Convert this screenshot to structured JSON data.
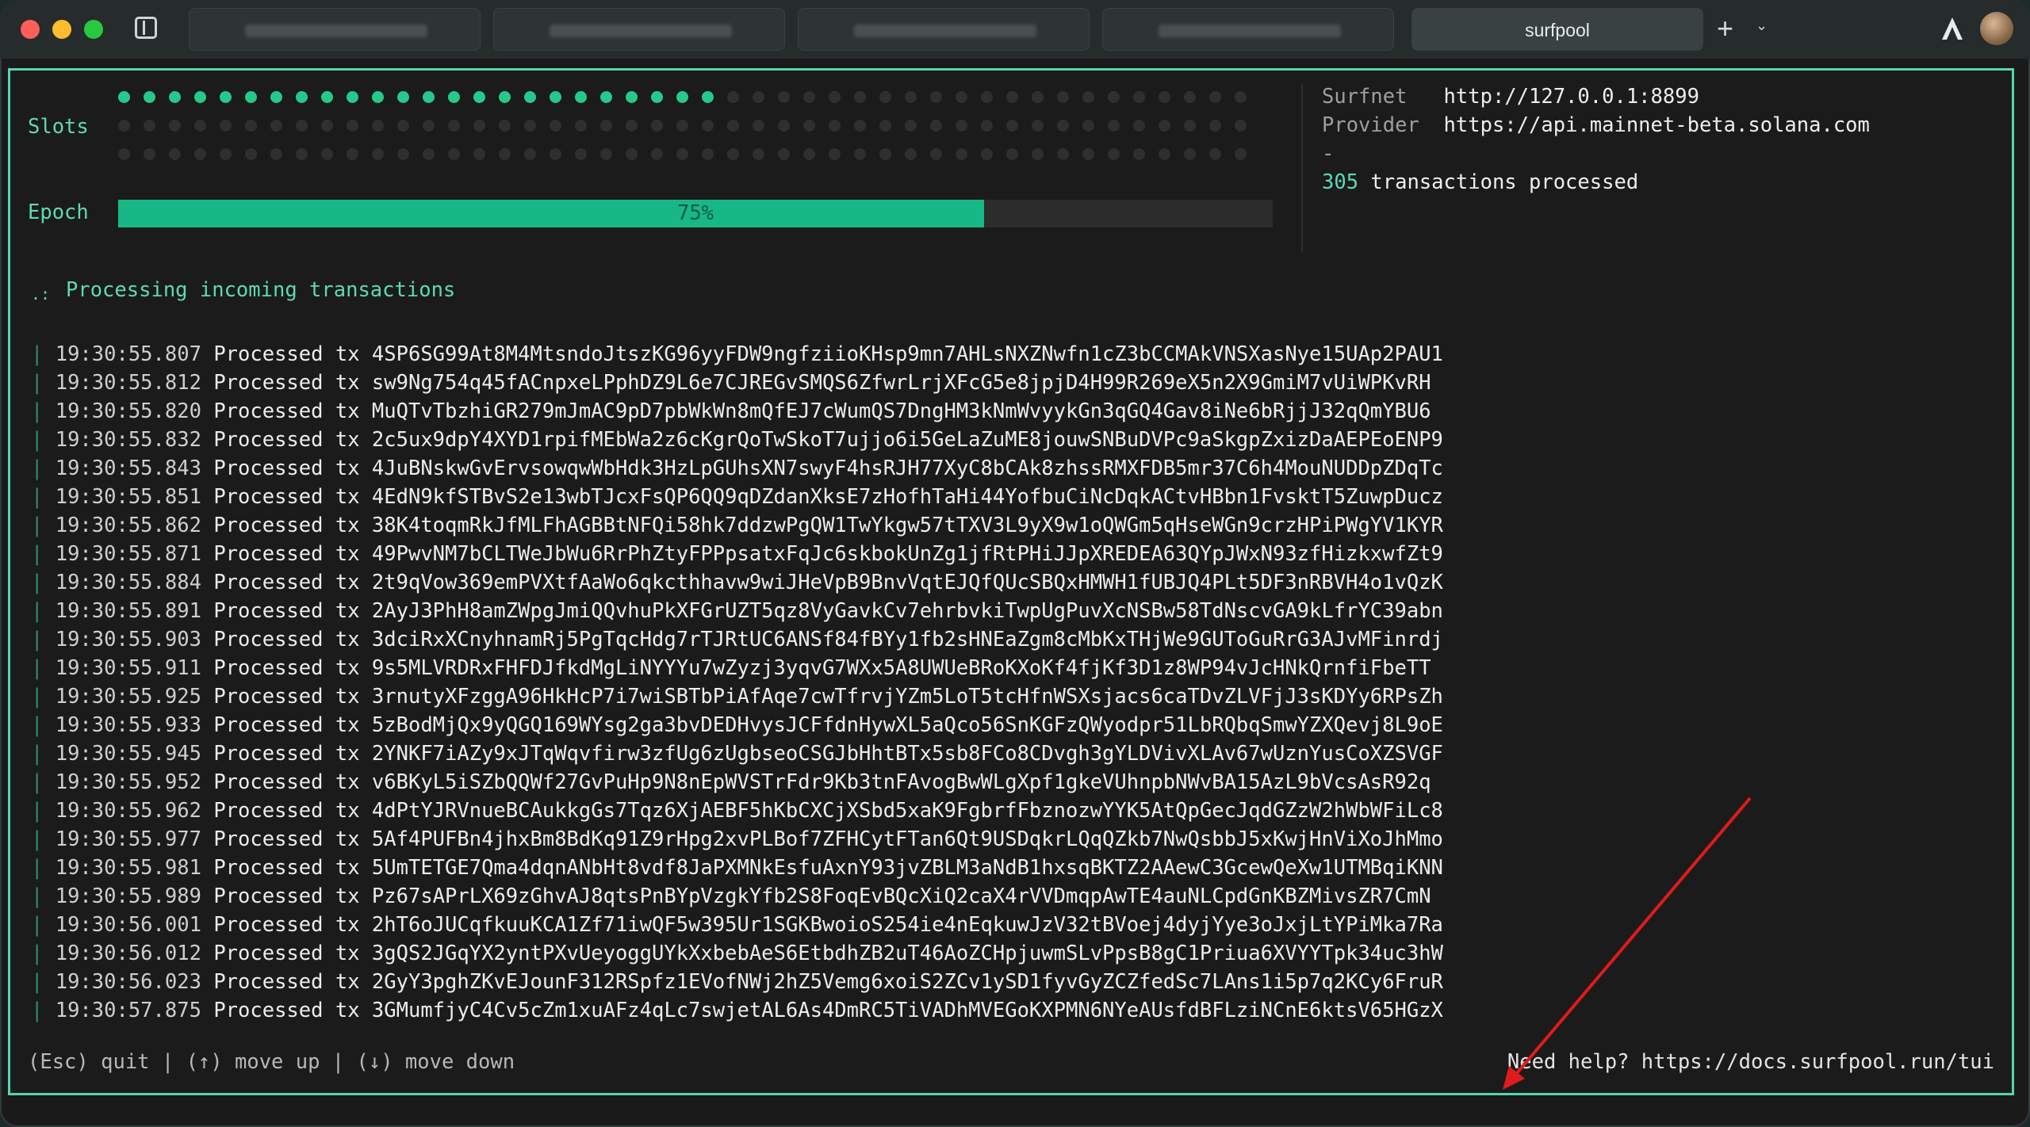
{
  "titlebar": {
    "active_tab": "surfpool"
  },
  "panel": {
    "slots_label": "Slots",
    "slots_total": 135,
    "slots_filled": 24,
    "epoch_label": "Epoch",
    "epoch_progress": 0.75,
    "epoch_percent_text": "75%",
    "surfnet_label": "Surfnet",
    "surfnet_url": "http://127.0.0.1:8899",
    "provider_label": "Provider",
    "provider_url": "https://api.mainnet-beta.solana.com",
    "separator": "-",
    "tx_count": "305",
    "tx_count_suffix": "transactions processed",
    "status_text": "Processing incoming transactions",
    "spinner_glyph": ".:"
  },
  "log": {
    "action": "Processed tx",
    "rows": [
      {
        "time": "19:30:55.807",
        "sig": "4SP6SG99At8M4MtsndoJtszKG96yyFDW9ngfziioKHsp9mn7AHLsNXZNwfn1cZ3bCCMAkVNSXasNye15UAp2PAU1"
      },
      {
        "time": "19:30:55.812",
        "sig": "sw9Ng754q45fACnpxeLPphDZ9L6e7CJREGvSMQS6ZfwrLrjXFcG5e8jpjD4H99R269eX5n2X9GmiM7vUiWPKvRH"
      },
      {
        "time": "19:30:55.820",
        "sig": "MuQTvTbzhiGR279mJmAC9pD7pbWkWn8mQfEJ7cWumQS7DngHM3kNmWvyykGn3qGQ4Gav8iNe6bRjjJ32qQmYBU6"
      },
      {
        "time": "19:30:55.832",
        "sig": "2c5ux9dpY4XYD1rpifMEbWa2z6cKgrQoTwSkoT7ujjo6i5GeLaZuME8jouwSNBuDVPc9aSkgpZxizDaAEPEoENP9"
      },
      {
        "time": "19:30:55.843",
        "sig": "4JuBNskwGvErvsowqwWbHdk3HzLpGUhsXN7swyF4hsRJH77XyC8bCAk8zhssRMXFDB5mr37C6h4MouNUDDpZDqTc"
      },
      {
        "time": "19:30:55.851",
        "sig": "4EdN9kfSTBvS2e13wbTJcxFsQP6QQ9qDZdanXksE7zHofhTaHi44YofbuCiNcDqkACtvHBbn1FvsktT5ZuwpDucz"
      },
      {
        "time": "19:30:55.862",
        "sig": "38K4toqmRkJfMLFhAGBBtNFQi58hk7ddzwPgQW1TwYkgw57tTXV3L9yX9w1oQWGm5qHseWGn9crzHPiPWgYV1KYR"
      },
      {
        "time": "19:30:55.871",
        "sig": "49PwvNM7bCLTWeJbWu6RrPhZtyFPPpsatxFqJc6skbokUnZg1jfRtPHiJJpXREDEA63QYpJWxN93zfHizkxwfZt9"
      },
      {
        "time": "19:30:55.884",
        "sig": "2t9qVow369emPVXtfAaWo6qkcthhavw9wiJHeVpB9BnvVqtEJQfQUcSBQxHMWH1fUBJQ4PLt5DF3nRBVH4o1vQzK"
      },
      {
        "time": "19:30:55.891",
        "sig": "2AyJ3PhH8amZWpgJmiQQvhuPkXFGrUZT5qz8VyGavkCv7ehrbvkiTwpUgPuvXcNSBw58TdNscvGA9kLfrYC39abn"
      },
      {
        "time": "19:30:55.903",
        "sig": "3dciRxXCnyhnamRj5PgTqcHdg7rTJRtUC6ANSf84fBYy1fb2sHNEaZgm8cMbKxTHjWe9GUToGuRrG3AJvMFinrdj"
      },
      {
        "time": "19:30:55.911",
        "sig": "9s5MLVRDRxFHFDJfkdMgLiNYYYu7wZyzj3yqvG7WXx5A8UWUeBRoKXoKf4fjKf3D1z8WP94vJcHNkQrnfiFbeTT"
      },
      {
        "time": "19:30:55.925",
        "sig": "3rnutyXFzggA96HkHcP7i7wiSBTbPiAfAqe7cwTfrvjYZm5LoT5tcHfnWSXsjacs6caTDvZLVFjJ3sKDYy6RPsZh"
      },
      {
        "time": "19:30:55.933",
        "sig": "5zBodMjQx9yQGQ169WYsg2ga3bvDEDHvysJCFfdnHywXL5aQco56SnKGFzQWyodpr51LbRQbqSmwYZXQevj8L9oE"
      },
      {
        "time": "19:30:55.945",
        "sig": "2YNKF7iAZy9xJTqWqvfirw3zfUg6zUgbseoCSGJbHhtBTx5sb8FCo8CDvgh3gYLDVivXLAv67wUznYusCoXZSVGF"
      },
      {
        "time": "19:30:55.952",
        "sig": "v6BKyL5iSZbQQWf27GvPuHp9N8nEpWVSTrFdr9Kb3tnFAvogBwWLgXpf1gkeVUhnpbNWvBA15AzL9bVcsAsR92q"
      },
      {
        "time": "19:30:55.962",
        "sig": "4dPtYJRVnueBCAukkgGs7Tqz6XjAEBF5hKbCXCjXSbd5xaK9FgbrfFbznozwYYK5AtQpGecJqdGZzW2hWbWFiLc8"
      },
      {
        "time": "19:30:55.977",
        "sig": "5Af4PUFBn4jhxBm8BdKq91Z9rHpg2xvPLBof7ZFHCytFTan6Qt9USDqkrLQqQZkb7NwQsbbJ5xKwjHnViXoJhMmo"
      },
      {
        "time": "19:30:55.981",
        "sig": "5UmTETGE7Qma4dqnANbHt8vdf8JaPXMNkEsfuAxnY93jvZBLM3aNdB1hxsqBKTZ2AAewC3GcewQeXw1UTMBqiKNN"
      },
      {
        "time": "19:30:55.989",
        "sig": "Pz67sAPrLX69zGhvAJ8qtsPnBYpVzgkYfb2S8FoqEvBQcXiQ2caX4rVVDmqpAwTE4auNLCpdGnKBZMivsZR7CmN"
      },
      {
        "time": "19:30:56.001",
        "sig": "2hT6oJUCqfkuuKCA1Zf71iwQF5w395Ur1SGKBwoioS254ie4nEqkuwJzV32tBVoej4dyjYye3oJxjLtYPiMka7Ra"
      },
      {
        "time": "19:30:56.012",
        "sig": "3gQS2JGqYX2yntPXvUeyoggUYkXxbebAeS6EtbdhZB2uT46AoZCHpjuwmSLvPpsB8gC1Priua6XVYYTpk34uc3hW"
      },
      {
        "time": "19:30:56.023",
        "sig": "2GyY3pghZKvEJounF312RSpfz1EVofNWj2hZ5Vemg6xoiS2ZCv1ySD1fyvGyZCZfedSc7LAns1i5p7q2KCy6FruR"
      },
      {
        "time": "19:30:57.875",
        "sig": "3GMumfjyC4Cv5cZm1xuAFz4qLc7swjetAL6As4DmRC5TiVADhMVEGoKXPMN6NYeAUsfdBFLziNCnE6ktsV65HGzX"
      }
    ]
  },
  "footer": {
    "help_keys": "(Esc) quit | (↑) move up | (↓) move down",
    "help_link": "Need help? https://docs.surfpool.run/tui"
  },
  "colors": {
    "accent": "#5dd9b4",
    "slot_on": "#26c98c",
    "epoch_fill": "#18b886",
    "annotation_arrow": "#e01b1b"
  }
}
